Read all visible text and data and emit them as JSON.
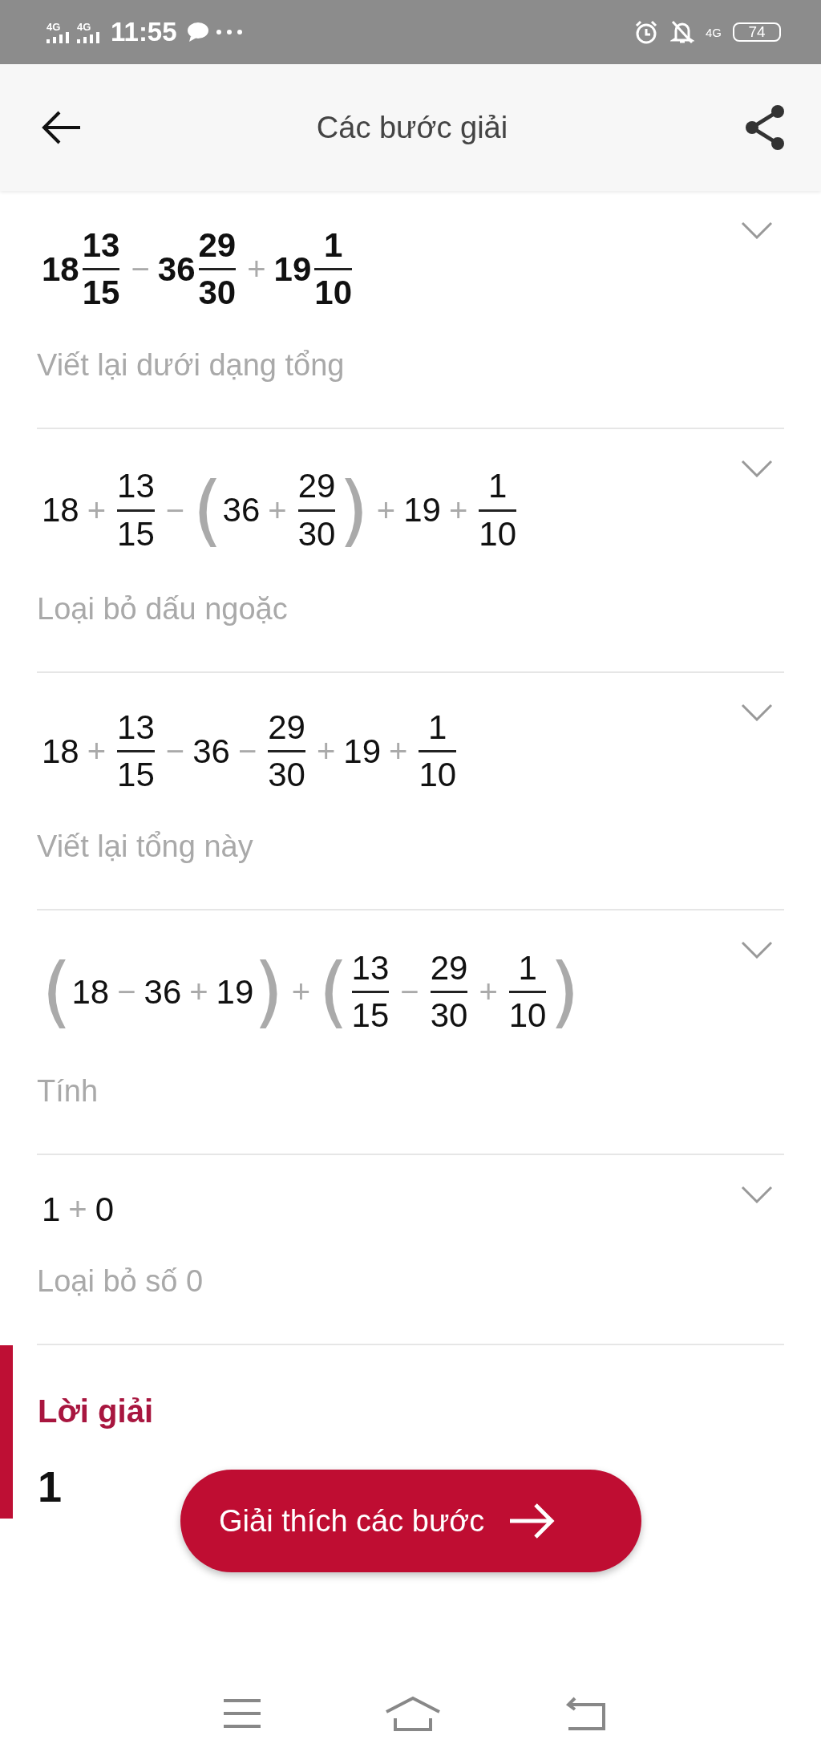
{
  "status_bar": {
    "networks": [
      "4G",
      "4G"
    ],
    "time": "11:55",
    "mobile_data": "4G",
    "battery": "74"
  },
  "app_bar": {
    "title": "Các bước giải"
  },
  "steps": [
    {
      "bold": true,
      "expression": [
        {
          "kind": "num",
          "text": "18"
        },
        {
          "kind": "frac",
          "num": "13",
          "den": "15"
        },
        {
          "kind": "op",
          "text": "−"
        },
        {
          "kind": "num",
          "text": "36"
        },
        {
          "kind": "frac",
          "num": "29",
          "den": "30"
        },
        {
          "kind": "op",
          "text": "+"
        },
        {
          "kind": "num",
          "text": "19"
        },
        {
          "kind": "frac",
          "num": "1",
          "den": "10"
        }
      ],
      "caption": "Viết lại dưới dạng tổng"
    },
    {
      "bold": false,
      "expression": [
        {
          "kind": "num",
          "text": "18"
        },
        {
          "kind": "op",
          "text": "+"
        },
        {
          "kind": "frac",
          "num": "13",
          "den": "15"
        },
        {
          "kind": "op",
          "text": "−"
        },
        {
          "kind": "group",
          "open": "(",
          "close": ")",
          "children": [
            {
              "kind": "num",
              "text": "36"
            },
            {
              "kind": "op",
              "text": "+"
            },
            {
              "kind": "frac",
              "num": "29",
              "den": "30"
            }
          ]
        },
        {
          "kind": "op",
          "text": "+"
        },
        {
          "kind": "num",
          "text": "19"
        },
        {
          "kind": "op",
          "text": "+"
        },
        {
          "kind": "frac",
          "num": "1",
          "den": "10"
        }
      ],
      "caption": "Loại bỏ dấu ngoặc"
    },
    {
      "bold": false,
      "expression": [
        {
          "kind": "num",
          "text": "18"
        },
        {
          "kind": "op",
          "text": "+"
        },
        {
          "kind": "frac",
          "num": "13",
          "den": "15"
        },
        {
          "kind": "op",
          "text": "−"
        },
        {
          "kind": "num",
          "text": "36"
        },
        {
          "kind": "op",
          "text": "−"
        },
        {
          "kind": "frac",
          "num": "29",
          "den": "30"
        },
        {
          "kind": "op",
          "text": "+"
        },
        {
          "kind": "num",
          "text": "19"
        },
        {
          "kind": "op",
          "text": "+"
        },
        {
          "kind": "frac",
          "num": "1",
          "den": "10"
        }
      ],
      "caption": "Viết lại tổng này"
    },
    {
      "bold": false,
      "expression": [
        {
          "kind": "group",
          "open": "(",
          "close": ")",
          "children": [
            {
              "kind": "num",
              "text": "18"
            },
            {
              "kind": "op",
              "text": "−"
            },
            {
              "kind": "num",
              "text": "36"
            },
            {
              "kind": "op",
              "text": "+"
            },
            {
              "kind": "num",
              "text": "19"
            }
          ]
        },
        {
          "kind": "op",
          "text": "+"
        },
        {
          "kind": "group",
          "open": "(",
          "close": ")",
          "children": [
            {
              "kind": "frac",
              "num": "13",
              "den": "15"
            },
            {
              "kind": "op",
              "text": "−"
            },
            {
              "kind": "frac",
              "num": "29",
              "den": "30"
            },
            {
              "kind": "op",
              "text": "+"
            },
            {
              "kind": "frac",
              "num": "1",
              "den": "10"
            }
          ]
        }
      ],
      "caption": "Tính"
    },
    {
      "bold": false,
      "expression": [
        {
          "kind": "num",
          "text": "1"
        },
        {
          "kind": "op",
          "text": "+"
        },
        {
          "kind": "num",
          "text": "0"
        }
      ],
      "caption": "Loại bỏ số 0"
    }
  ],
  "solution": {
    "heading": "Lời giải",
    "answer": "1"
  },
  "explain_button": {
    "label": "Giải thích các bước"
  }
}
